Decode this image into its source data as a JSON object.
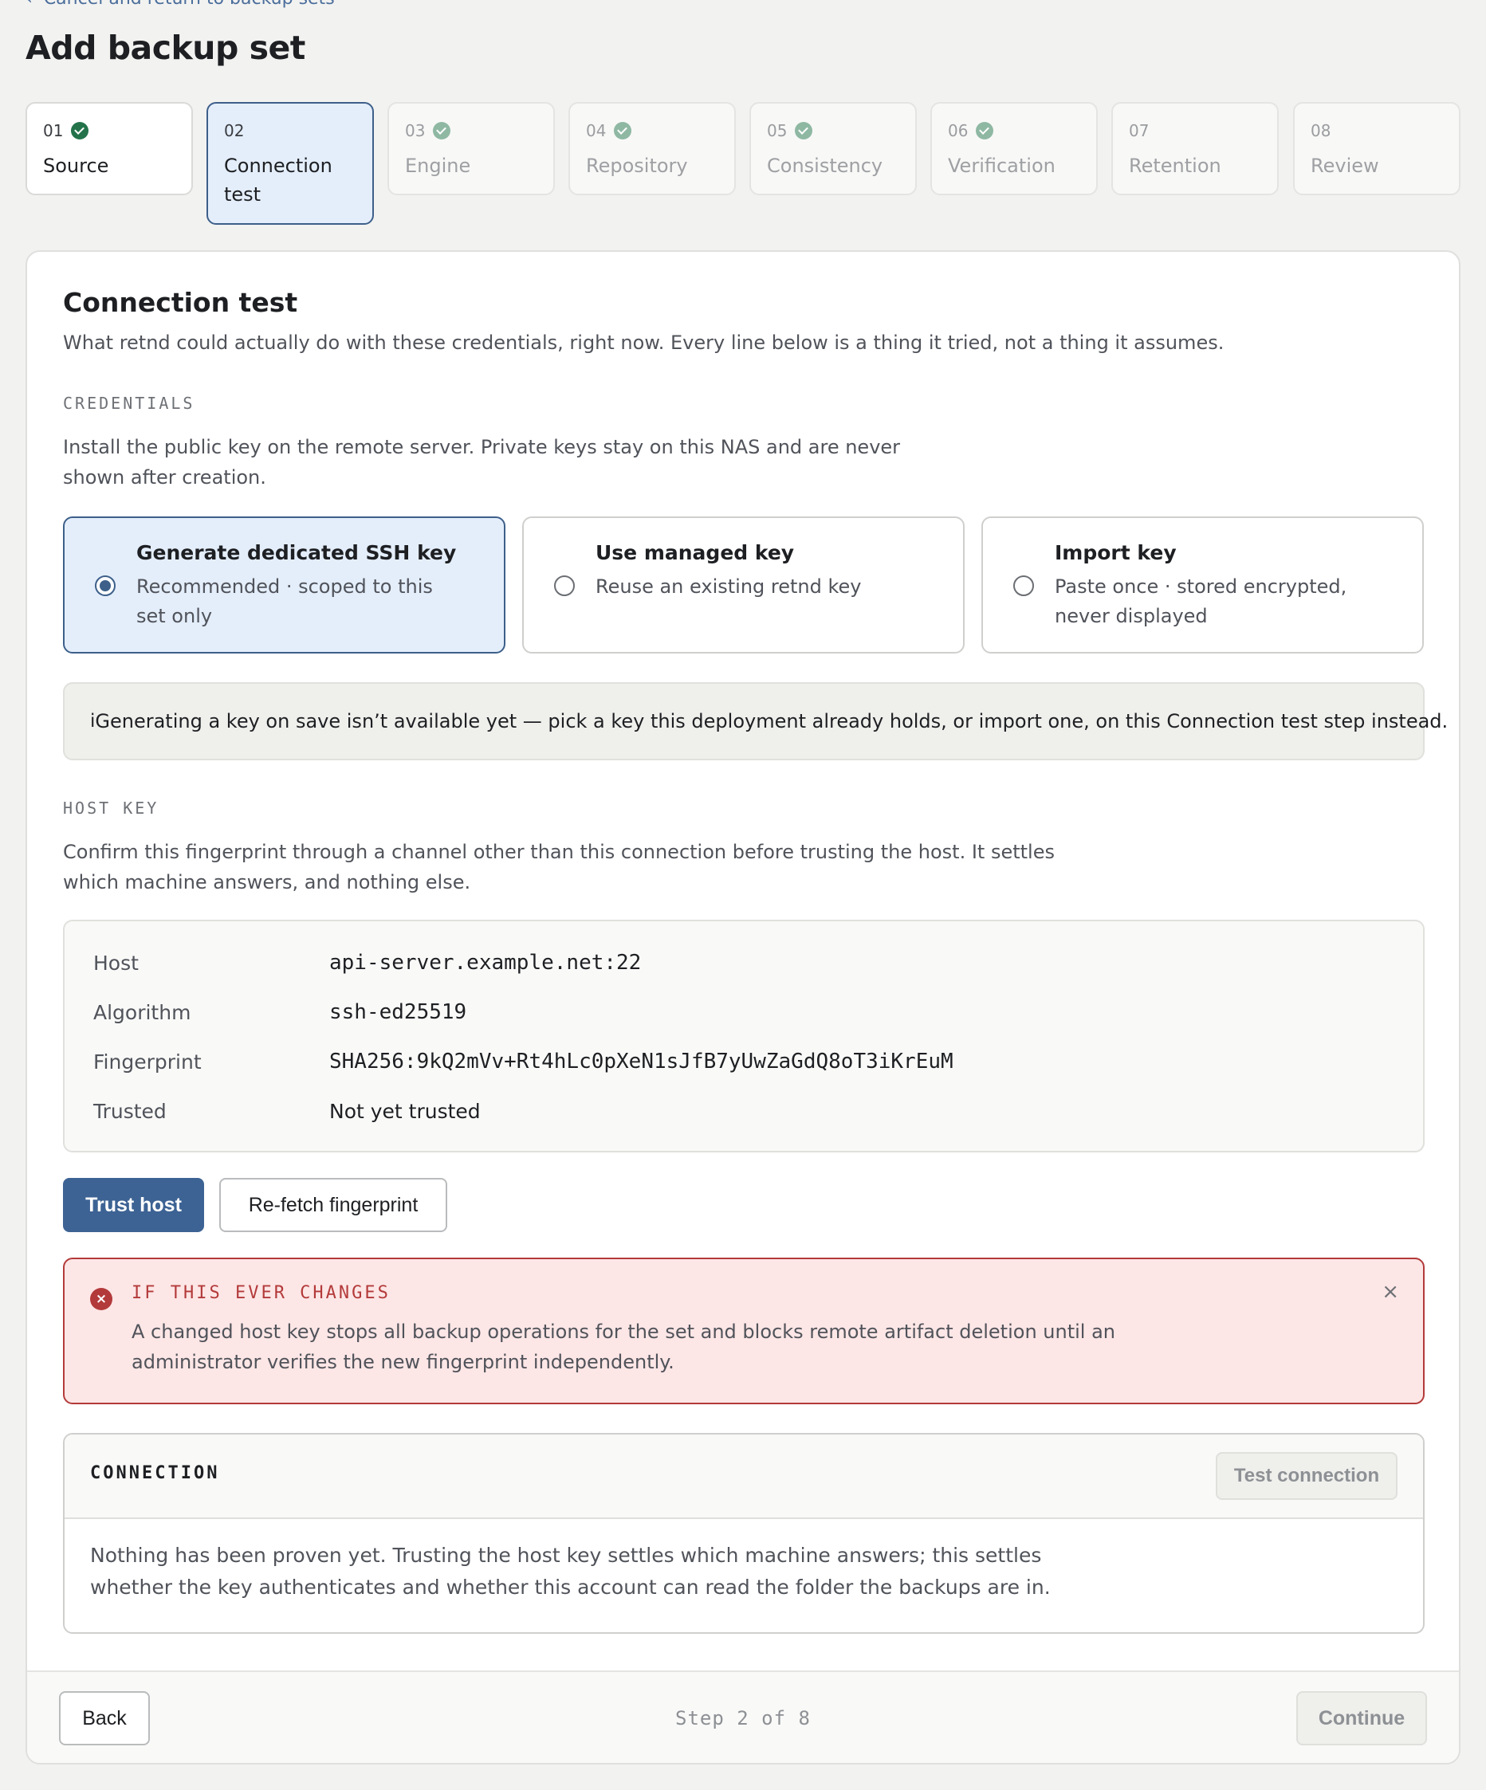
{
  "nav": {
    "back_label": "Cancel and return to backup sets"
  },
  "page": {
    "title": "Add backup set"
  },
  "steps": [
    {
      "num": "01",
      "label": "Source",
      "state": "done"
    },
    {
      "num": "02",
      "label": "Connection test",
      "state": "active"
    },
    {
      "num": "03",
      "label": "Engine",
      "state": "checked-muted"
    },
    {
      "num": "04",
      "label": "Repository",
      "state": "checked-muted"
    },
    {
      "num": "05",
      "label": "Consistency",
      "state": "checked-muted"
    },
    {
      "num": "06",
      "label": "Verification",
      "state": "checked-muted"
    },
    {
      "num": "07",
      "label": "Retention",
      "state": "pending"
    },
    {
      "num": "08",
      "label": "Review",
      "state": "pending"
    }
  ],
  "section": {
    "title": "Connection test",
    "lead": "What retnd could actually do with these credentials, right now. Every line below is a thing it tried, not a thing it assumes."
  },
  "credentials": {
    "label": "CREDENTIALS",
    "description": "Install the public key on the remote server. Private keys stay on this NAS and are never shown after creation.",
    "options": [
      {
        "title": "Generate dedicated SSH key",
        "desc": "Recommended · scoped to this set only",
        "selected": true
      },
      {
        "title": "Use managed key",
        "desc": "Reuse an existing retnd key",
        "selected": false
      },
      {
        "title": "Import key",
        "desc": "Paste once · stored encrypted, never displayed",
        "selected": false
      }
    ],
    "notice_icon": "i",
    "notice": "Generating a key on save isn’t available yet — pick a key this deployment already holds, or import one, on this Connection test step instead."
  },
  "host_key": {
    "label": "HOST KEY",
    "description": "Confirm this fingerprint through a channel other than this connection before trusting the host. It settles which machine answers, and nothing else.",
    "rows": [
      {
        "key": "Host",
        "value": "api-server.example.net:22"
      },
      {
        "key": "Algorithm",
        "value": "ssh-ed25519"
      },
      {
        "key": "Fingerprint",
        "value": "SHA256:9kQ2mVv+Rt4hLc0pXeN1sJfB7yUwZaGdQ8oT3iKrEuM"
      },
      {
        "key": "Trusted",
        "value": "Not yet trusted"
      }
    ],
    "trust_button": "Trust host",
    "refetch_button": "Re-fetch fingerprint"
  },
  "alert": {
    "title": "IF THIS EVER CHANGES",
    "body": "A changed host key stops all backup operations for the set and blocks remote artifact deletion until an administrator verifies the new fingerprint independently.",
    "close": "×"
  },
  "connection": {
    "label": "CONNECTION",
    "test_button": "Test connection",
    "body": "Nothing has been proven yet. Trusting the host key settles which machine answers; this settles whether the key authenticates and whether this account can read the folder the backups are in."
  },
  "footer": {
    "back_button": "Back",
    "step_indicator": "Step 2 of 8",
    "continue_button": "Continue"
  },
  "colors": {
    "accent": "#3d6394",
    "selected_bg": "#e4eefb",
    "success": "#23724a",
    "danger": "#b33a3a"
  }
}
